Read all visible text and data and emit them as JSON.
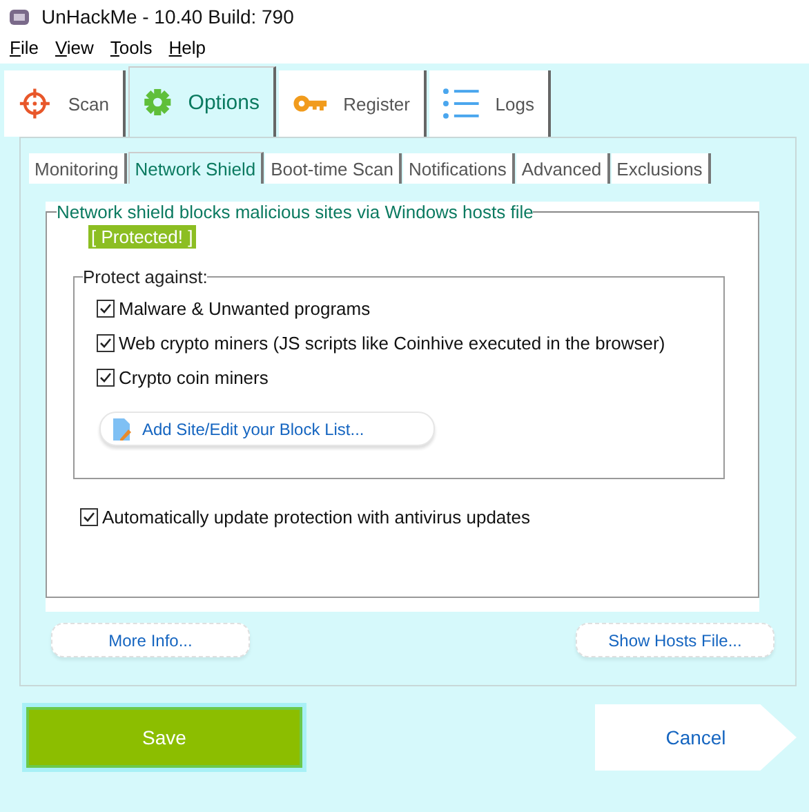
{
  "window": {
    "title": "UnHackMe - 10.40 Build: 790"
  },
  "menu": [
    {
      "label": "File"
    },
    {
      "label": "View"
    },
    {
      "label": "Tools"
    },
    {
      "label": "Help"
    }
  ],
  "main_tabs": [
    {
      "label": "Scan",
      "selected": false
    },
    {
      "label": "Options",
      "selected": true
    },
    {
      "label": "Register",
      "selected": false
    },
    {
      "label": "Logs",
      "selected": false
    }
  ],
  "sub_tabs": [
    {
      "label": "Monitoring",
      "selected": false
    },
    {
      "label": "Network Shield",
      "selected": true
    },
    {
      "label": "Boot-time Scan",
      "selected": false
    },
    {
      "label": "Notifications",
      "selected": false
    },
    {
      "label": "Advanced",
      "selected": false
    },
    {
      "label": "Exclusions",
      "selected": false
    }
  ],
  "shield": {
    "title": "Network shield blocks malicious sites via Windows hosts file",
    "status": "[ Protected! ]",
    "protect_against": {
      "title": "Protect against:",
      "options": [
        {
          "label": "Malware & Unwanted programs",
          "checked": true
        },
        {
          "label": "Web crypto miners (JS scripts like Coinhive executed in the browser)",
          "checked": true
        },
        {
          "label": "Crypto coin miners",
          "checked": true
        }
      ],
      "edit_button": "Add Site/Edit your Block List..."
    },
    "auto_update": {
      "label": "Automatically update protection with antivirus updates",
      "checked": true
    }
  },
  "more_info_button": "More Info...",
  "show_hosts_button": "Show Hosts File...",
  "footer": {
    "save": "Save",
    "cancel": "Cancel"
  }
}
